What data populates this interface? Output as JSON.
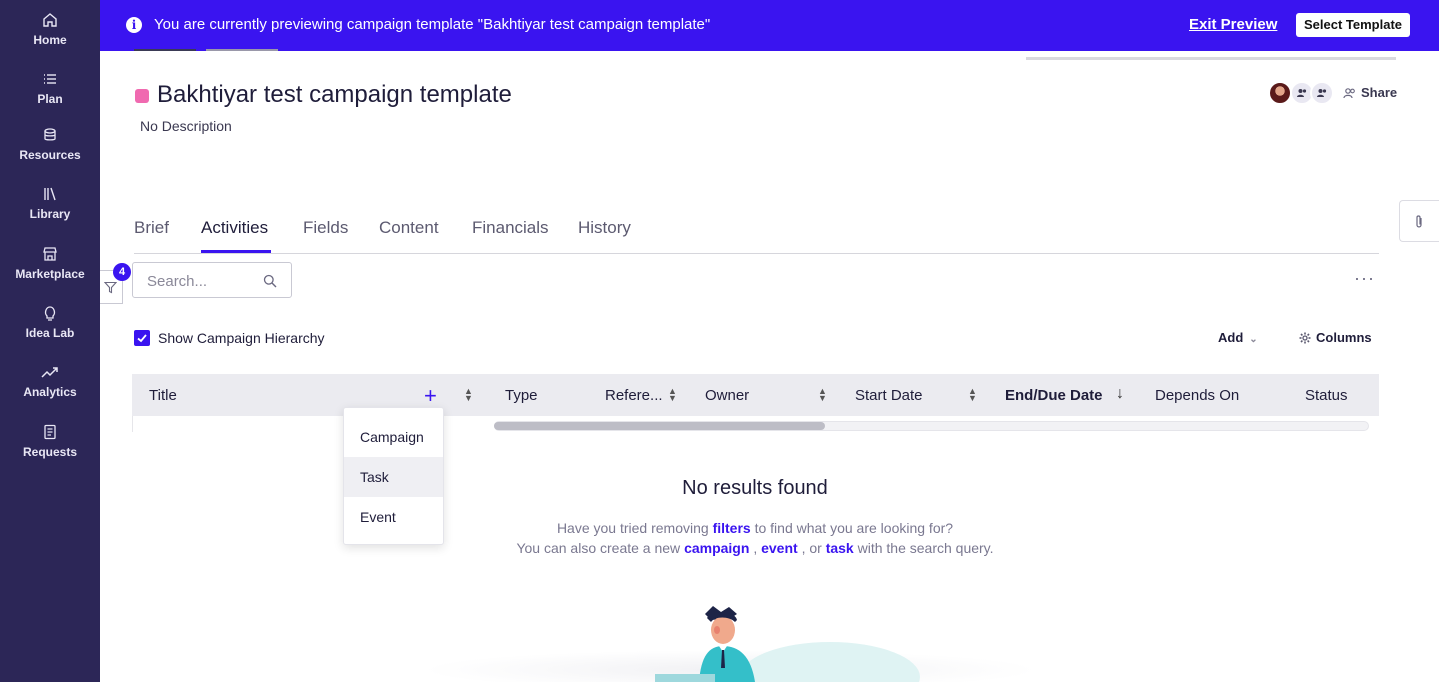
{
  "sidebar": {
    "items": [
      {
        "label": "Home",
        "icon": "home-icon"
      },
      {
        "label": "Plan",
        "icon": "list-icon"
      },
      {
        "label": "Resources",
        "icon": "database-icon"
      },
      {
        "label": "Library",
        "icon": "books-icon"
      },
      {
        "label": "Marketplace",
        "icon": "store-icon"
      },
      {
        "label": "Idea Lab",
        "icon": "lightbulb-icon"
      },
      {
        "label": "Analytics",
        "icon": "trend-icon"
      },
      {
        "label": "Requests",
        "icon": "document-icon"
      }
    ]
  },
  "banner": {
    "message": "You are currently previewing campaign template \"Bakhtiyar test campaign template\"",
    "exit_label": "Exit Preview",
    "select_label": "Select Template",
    "color": "#3a14f0"
  },
  "header": {
    "title": "Bakhtiyar test campaign template",
    "description": "No Description",
    "share_label": "Share",
    "color_tag": "#f06ab0"
  },
  "tabs": [
    {
      "label": "Brief",
      "active": false
    },
    {
      "label": "Activities",
      "active": true
    },
    {
      "label": "Fields",
      "active": false
    },
    {
      "label": "Content",
      "active": false
    },
    {
      "label": "Financials",
      "active": false
    },
    {
      "label": "History",
      "active": false
    }
  ],
  "toolbar": {
    "filter_count": "4",
    "search_placeholder": "Search...",
    "show_hierarchy_label": "Show Campaign Hierarchy",
    "show_hierarchy_checked": true,
    "add_label": "Add",
    "columns_label": "Columns"
  },
  "table": {
    "columns": [
      "Title",
      "Type",
      "Refere...",
      "Owner",
      "Start Date",
      "End/Due Date",
      "Depends On",
      "Status"
    ]
  },
  "add_menu": {
    "items": [
      "Campaign",
      "Task",
      "Event"
    ],
    "hovered": "Task"
  },
  "empty_state": {
    "title": "No results found",
    "line1_pre": "Have you tried removing",
    "line1_link": "filters",
    "line1_post": "to find what you are looking for?",
    "line2_pre": "You can also create a new",
    "link_campaign": "campaign",
    "sep1": ",",
    "link_event": "event",
    "sep2": ", or",
    "link_task": "task",
    "line2_post": "with the search query."
  }
}
